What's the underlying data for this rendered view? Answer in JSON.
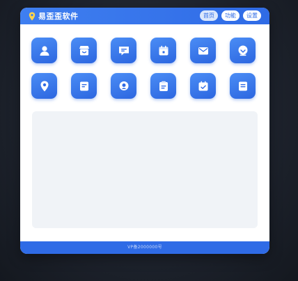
{
  "app": {
    "title": "易歪歪软件",
    "logo_icon": "location-pin-icon"
  },
  "nav": {
    "items": [
      {
        "label": "首页",
        "active": true
      },
      {
        "label": "功能",
        "active": false
      },
      {
        "label": "设置",
        "active": false
      }
    ]
  },
  "tiles": {
    "row1": [
      "user-icon",
      "store-icon",
      "chat-icon",
      "calendar-icon",
      "mail-icon",
      "download-icon"
    ],
    "row2": [
      "location-icon",
      "document-icon",
      "support-icon",
      "clipboard-icon",
      "calendar-check-icon",
      "note-icon"
    ]
  },
  "footer": {
    "text": "VP备2000000号"
  },
  "colors": {
    "accent": "#2f6be6",
    "tile_light": "#4b8df5",
    "content_bg": "#f0f3f7"
  }
}
